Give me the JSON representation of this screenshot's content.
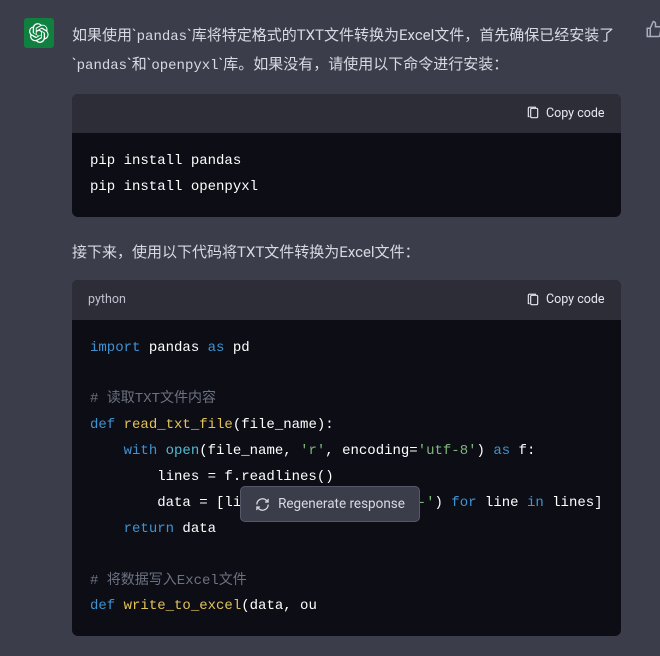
{
  "message": {
    "intro_parts": [
      "如果使用`",
      "pandas",
      "`库将特定格式的TXT文件转换为Excel文件，首先确保已经安装了`",
      "pandas",
      "`和`",
      "openpyxl",
      "`库。如果没有，请使用以下命令进行安装："
    ],
    "mid": "接下来，使用以下代码将TXT文件转换为Excel文件："
  },
  "code1": {
    "lang": "",
    "copy": "Copy code",
    "lines": [
      "pip install pandas",
      "pip install openpyxl"
    ]
  },
  "code2": {
    "lang": "python",
    "copy": "Copy code",
    "tokens": [
      [
        [
          "kw",
          "import"
        ],
        [
          "plain",
          " pandas "
        ],
        [
          "kw",
          "as"
        ],
        [
          "plain",
          " pd"
        ]
      ],
      [],
      [
        [
          "cmt",
          "# 读取TXT文件内容"
        ]
      ],
      [
        [
          "kw",
          "def "
        ],
        [
          "fn",
          "read_txt_file"
        ],
        [
          "plain",
          "(file_name):"
        ]
      ],
      [
        [
          "plain",
          "    "
        ],
        [
          "kw",
          "with"
        ],
        [
          "plain",
          " "
        ],
        [
          "call",
          "open"
        ],
        [
          "plain",
          "(file_name, "
        ],
        [
          "str",
          "'r'"
        ],
        [
          "plain",
          ", encoding="
        ],
        [
          "str",
          "'utf-8'"
        ],
        [
          "plain",
          ") "
        ],
        [
          "kw",
          "as"
        ],
        [
          "plain",
          " f:"
        ]
      ],
      [
        [
          "plain",
          "        lines = f.readlines()"
        ]
      ],
      [
        [
          "plain",
          "        data = [line.strip().split("
        ],
        [
          "str",
          "'----'"
        ],
        [
          "plain",
          ") "
        ],
        [
          "kw",
          "for"
        ],
        [
          "plain",
          " line "
        ],
        [
          "kw",
          "in"
        ],
        [
          "plain",
          " lines]"
        ]
      ],
      [
        [
          "plain",
          "    "
        ],
        [
          "kw",
          "return"
        ],
        [
          "plain",
          " data"
        ]
      ],
      [],
      [
        [
          "cmt",
          "# 将数据写入Excel文件"
        ]
      ],
      [
        [
          "kw",
          "def "
        ],
        [
          "fn",
          "write_to_excel"
        ],
        [
          "plain",
          "(data, ou"
        ]
      ]
    ]
  },
  "regen": "Regenerate response"
}
